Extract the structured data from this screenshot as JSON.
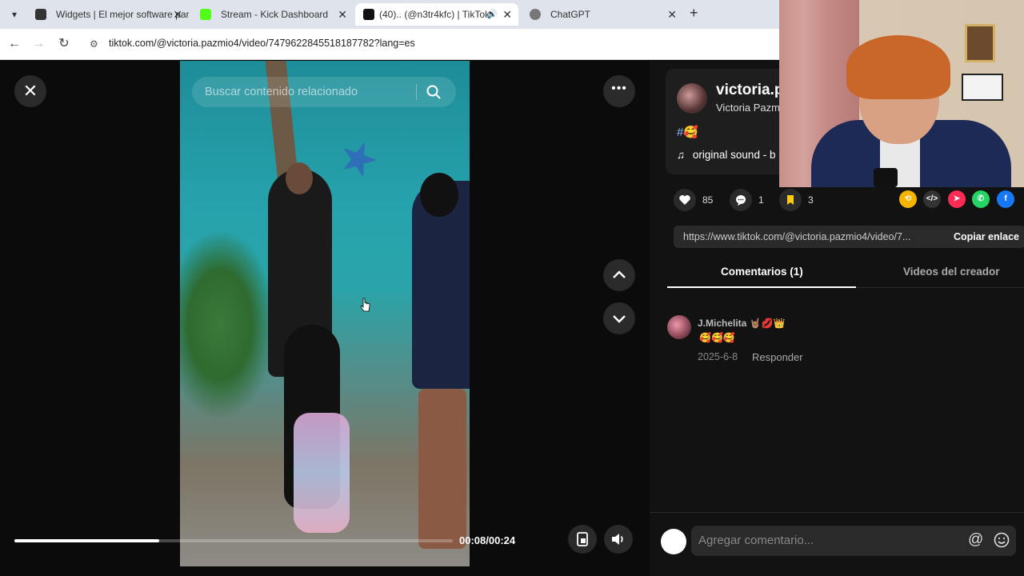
{
  "browser": {
    "tabs": [
      {
        "title": "Widgets | El mejor software par",
        "active": false,
        "favicon_color": "#333333"
      },
      {
        "title": "Stream - Kick Dashboard",
        "active": false,
        "favicon_color": "#53fc18"
      },
      {
        "title": "(40).. (@n3tr4kfc) | TikTok",
        "active": true,
        "favicon_color": "#111111"
      },
      {
        "title": "ChatGPT",
        "active": false,
        "favicon_color": "#777777"
      }
    ],
    "url": "tiktok.com/@victoria.pazmio4/video/7479622845518187782?lang=es"
  },
  "player": {
    "search_placeholder": "Buscar contenido relacionado",
    "time_display": "00:08/00:24",
    "progress_fraction": 0.33
  },
  "creator": {
    "name": "victoria.p",
    "nickname": "Victoria Pazm",
    "description_hashtag": "#",
    "description_emoji": "🥰",
    "sound": "original sound - b"
  },
  "actions": {
    "likes": "85",
    "comments": "1",
    "saves": "3"
  },
  "share": {
    "link": "https://www.tiktok.com/@victoria.pazmio4/video/7...",
    "copy_label": "Copiar enlace"
  },
  "tabs": {
    "comments": "Comentarios (1)",
    "creator_videos": "Videos del creador"
  },
  "comment": {
    "user": "J.Michelita 🤘🏽💋👑",
    "text": "🥰🥰🥰",
    "date": "2025-6-8",
    "reply": "Responder"
  },
  "comment_input": {
    "placeholder": "Agregar comentario...",
    "at_symbol": "@"
  },
  "colors": {
    "like_icon": "#ffffff",
    "save_icon": "#facc15",
    "hashtag": "#8ab4ff",
    "share_repost": "#f4b400",
    "share_embed": "#333333",
    "share_send": "#fe2c55",
    "share_whatsapp": "#25d366",
    "share_facebook": "#1877f2"
  }
}
